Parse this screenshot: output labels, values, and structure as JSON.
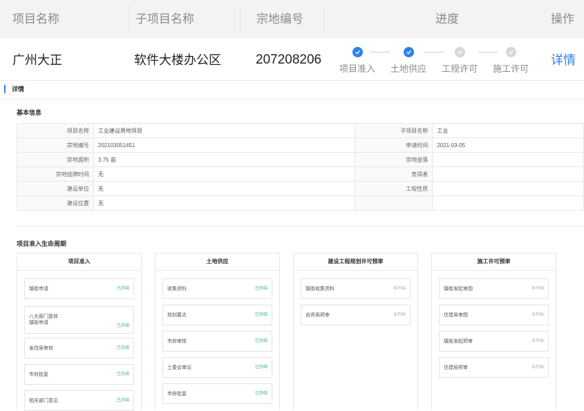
{
  "header": {
    "col_name": "项目名称",
    "col_sub": "子项目名称",
    "col_code": "宗地编号",
    "col_progress": "进度",
    "col_action": "操作"
  },
  "project_row": {
    "name": "广州大正",
    "sub": "软件大楼办公区",
    "code": "207208206",
    "action": "详情",
    "steps": [
      {
        "label": "项目准入",
        "status": "done"
      },
      {
        "label": "土地供应",
        "status": "done"
      },
      {
        "label": "工规许可",
        "status": "todo"
      },
      {
        "label": "施工许可",
        "status": "todo"
      }
    ]
  },
  "detail": {
    "title": "详情",
    "basic_title": "基本信息",
    "rows": [
      {
        "k1": "项目名称",
        "v1": "工业建设用地项目",
        "k2": "子项目名称",
        "v2": "工业"
      },
      {
        "k1": "宗地编号",
        "v1": "202103051451",
        "k2": "申请时间",
        "v2": "2021-03-05"
      },
      {
        "k1": "宗地面积",
        "v1": "3.75 亩",
        "k2": "宗地坐落",
        "v2": ""
      },
      {
        "k1": "宗地挂牌时间",
        "v1": "无",
        "k2": "竞得者",
        "v2": ""
      },
      {
        "k1": "建设单位",
        "v1": "无",
        "k2": "工程性质",
        "v2": ""
      },
      {
        "k1": "建设位置",
        "v1": "无",
        "k2": "",
        "v2": ""
      }
    ],
    "lifecycle_title": "项目准入生命周期",
    "columns": [
      {
        "title": "项目准入",
        "cards": [
          {
            "lines": [
              "镇街申请"
            ],
            "status": "已办结",
            "state": "done"
          },
          {
            "lines": [
              "八大部门复核",
              "镇街申请"
            ],
            "status": "已办结",
            "state": "done"
          },
          {
            "lines": [
              "发改局审核"
            ],
            "status": "已办结",
            "state": "done"
          },
          {
            "lines": [
              "市府批复"
            ],
            "status": "已办结",
            "state": "done"
          },
          {
            "lines": [
              "相关部门意见"
            ],
            "status": "已办结",
            "state": "done"
          }
        ]
      },
      {
        "title": "土地供应",
        "cards": [
          {
            "lines": [
              "收集资料"
            ],
            "status": "已办结",
            "state": "done"
          },
          {
            "lines": [
              "规划要点"
            ],
            "status": "已办结",
            "state": "done"
          },
          {
            "lines": [
              "市府审核"
            ],
            "status": "已办结",
            "state": "done"
          },
          {
            "lines": [
              "土委会审议"
            ],
            "status": "已办结",
            "state": "done"
          },
          {
            "lines": [
              "市府批复"
            ],
            "status": "已办结",
            "state": "done"
          }
        ]
      },
      {
        "title": "建设工程规划许可预审",
        "cards": [
          {
            "lines": [
              "镇街收集资料"
            ],
            "status": "未开始",
            "state": "todo"
          },
          {
            "lines": [
              "自资局预审"
            ],
            "status": "未开始",
            "state": "todo"
          }
        ]
      },
      {
        "title": "施工许可预审",
        "cards": [
          {
            "lines": [
              "镇街发起审图"
            ],
            "status": "未开始",
            "state": "todo"
          },
          {
            "lines": [
              "住建局审图"
            ],
            "status": "未开始",
            "state": "todo"
          },
          {
            "lines": [
              "镇街发起预审"
            ],
            "status": "未开始",
            "state": "todo"
          },
          {
            "lines": [
              "住建局预审"
            ],
            "status": "未开始",
            "state": "todo"
          }
        ]
      }
    ]
  }
}
